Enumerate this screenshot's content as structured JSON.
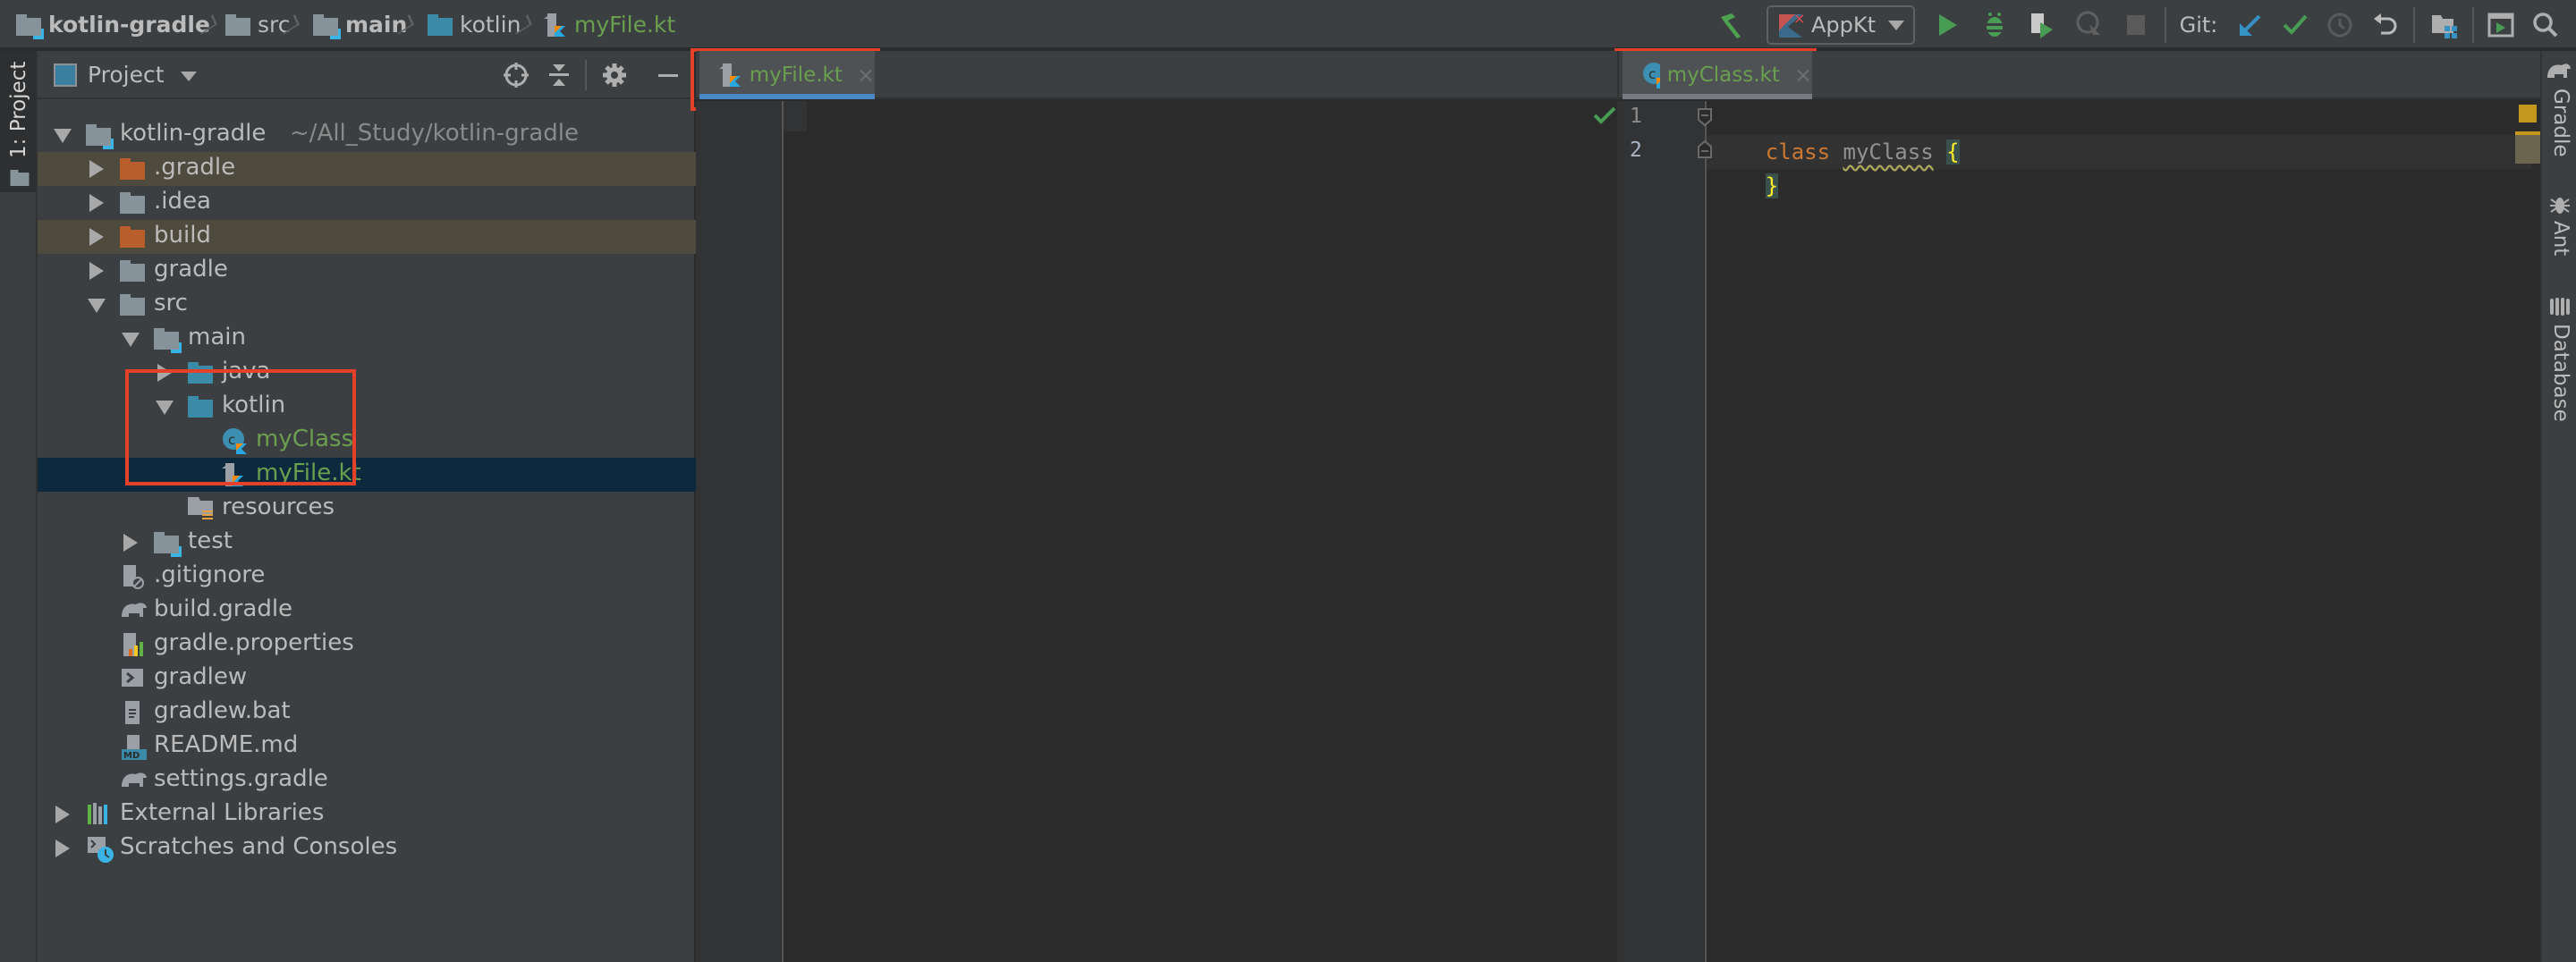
{
  "navbar": {
    "breadcrumbs": [
      {
        "label": "kotlin-gradle",
        "icon": "module-folder-icon"
      },
      {
        "label": "src",
        "icon": "folder-icon"
      },
      {
        "label": "main",
        "icon": "source-root-folder-icon"
      },
      {
        "label": "kotlin",
        "icon": "source-folder-icon"
      },
      {
        "label": "myFile.kt",
        "icon": "kotlin-file-icon"
      }
    ],
    "run_config": "AppKt",
    "git_label": "Git:",
    "actions": [
      "build-hammer-icon",
      "run-icon",
      "debug-icon",
      "run-with-coverage-icon",
      "profile-icon",
      "stop-icon",
      "git-update-icon",
      "git-commit-icon",
      "git-history-icon",
      "git-rollback-icon",
      "project-structure-icon",
      "terminal-icon",
      "search-icon"
    ]
  },
  "left_stripe": {
    "project_tab": "1: Project"
  },
  "right_stripe": {
    "tabs": [
      "Gradle",
      "Ant",
      "Database"
    ]
  },
  "project_panel": {
    "title": "Project",
    "tree": [
      {
        "label": "kotlin-gradle",
        "hint": "~/All_Study/kotlin-gradle",
        "depth": 0,
        "expanded": true,
        "icon": "module-folder-icon"
      },
      {
        "label": ".gradle",
        "depth": 1,
        "expanded": false,
        "icon": "excluded-folder-icon",
        "excluded": true
      },
      {
        "label": ".idea",
        "depth": 1,
        "expanded": false,
        "icon": "folder-icon"
      },
      {
        "label": "build",
        "depth": 1,
        "expanded": false,
        "icon": "excluded-folder-icon",
        "excluded": true
      },
      {
        "label": "gradle",
        "depth": 1,
        "expanded": false,
        "icon": "folder-icon"
      },
      {
        "label": "src",
        "depth": 1,
        "expanded": true,
        "icon": "folder-icon"
      },
      {
        "label": "main",
        "depth": 2,
        "expanded": true,
        "icon": "module-folder-icon"
      },
      {
        "label": "java",
        "depth": 3,
        "expanded": false,
        "icon": "source-folder-icon"
      },
      {
        "label": "kotlin",
        "depth": 3,
        "expanded": true,
        "icon": "source-folder-icon"
      },
      {
        "label": "myClass",
        "depth": 4,
        "icon": "kotlin-class-icon",
        "modified": true
      },
      {
        "label": "myFile.kt",
        "depth": 4,
        "icon": "kotlin-file-icon",
        "modified": true,
        "selected": true
      },
      {
        "label": "resources",
        "depth": 3,
        "icon": "resources-folder-icon"
      },
      {
        "label": "test",
        "depth": 2,
        "expanded": false,
        "icon": "module-folder-icon"
      },
      {
        "label": ".gitignore",
        "depth": 1,
        "icon": "gitignore-file-icon"
      },
      {
        "label": "build.gradle",
        "depth": 1,
        "icon": "gradle-elephant-icon"
      },
      {
        "label": "gradle.properties",
        "depth": 1,
        "icon": "properties-file-icon"
      },
      {
        "label": "gradlew",
        "depth": 1,
        "icon": "shell-script-icon"
      },
      {
        "label": "gradlew.bat",
        "depth": 1,
        "icon": "text-file-icon"
      },
      {
        "label": "README.md",
        "depth": 1,
        "icon": "markdown-file-icon"
      },
      {
        "label": "settings.gradle",
        "depth": 1,
        "icon": "gradle-elephant-icon"
      },
      {
        "label": "External Libraries",
        "depth": 0,
        "expanded": false,
        "icon": "libraries-icon"
      },
      {
        "label": "Scratches and Consoles",
        "depth": 0,
        "expanded": false,
        "icon": "scratches-icon"
      }
    ]
  },
  "editors": {
    "left": {
      "tab": "myFile.kt",
      "close": "×",
      "lines": []
    },
    "right": {
      "tab": "myClass.kt",
      "close": "×",
      "line_numbers": [
        "1",
        "2"
      ],
      "code": {
        "keyword": "class",
        "name": "myClass",
        "open": "{",
        "close": "}"
      }
    }
  },
  "colors": {
    "accent_tab_underline": "#4a88c7",
    "modified_file_green": "#6a9f4f",
    "highlight_box_red": "#e5402a",
    "keyword_orange": "#cc7832"
  }
}
